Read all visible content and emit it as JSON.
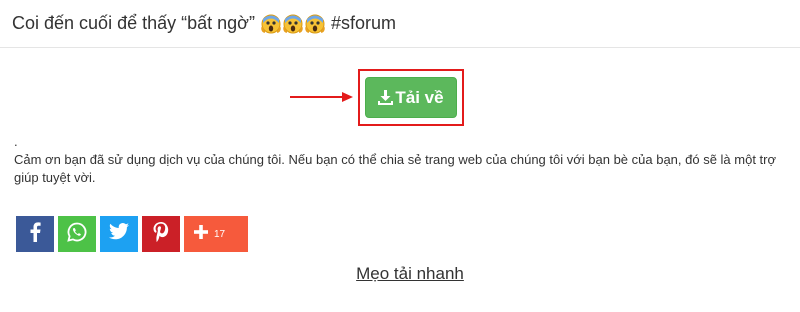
{
  "header": {
    "title": "Coi đến cuối để thấy “bất ngờ”",
    "hashtag": "#sforum",
    "emojis": [
      "screaming-face-emoji",
      "screaming-face-emoji",
      "screaming-face-emoji"
    ]
  },
  "download": {
    "label": "Tải về",
    "icon": "download-icon",
    "button_color": "#5cb85c",
    "highlight_color": "#e31b1b"
  },
  "content": {
    "dot": ".",
    "thanks_text": "Cảm ơn bạn đã sử dụng dịch vụ của chúng tôi. Nếu bạn có thể chia sẻ trang web của chúng tôi với bạn bè của bạn, đó sẽ là một trợ giúp tuyệt vời."
  },
  "share": {
    "buttons": [
      {
        "icon": "facebook-icon",
        "color": "#3b5998"
      },
      {
        "icon": "whatsapp-icon",
        "color": "#4dc247"
      },
      {
        "icon": "twitter-icon",
        "color": "#1da1f2"
      },
      {
        "icon": "pinterest-icon",
        "color": "#cb2027"
      },
      {
        "icon": "plus-icon",
        "color": "#f65a3c"
      }
    ],
    "more_count": "17"
  },
  "tips_link": "Mẹo tải nhanh"
}
